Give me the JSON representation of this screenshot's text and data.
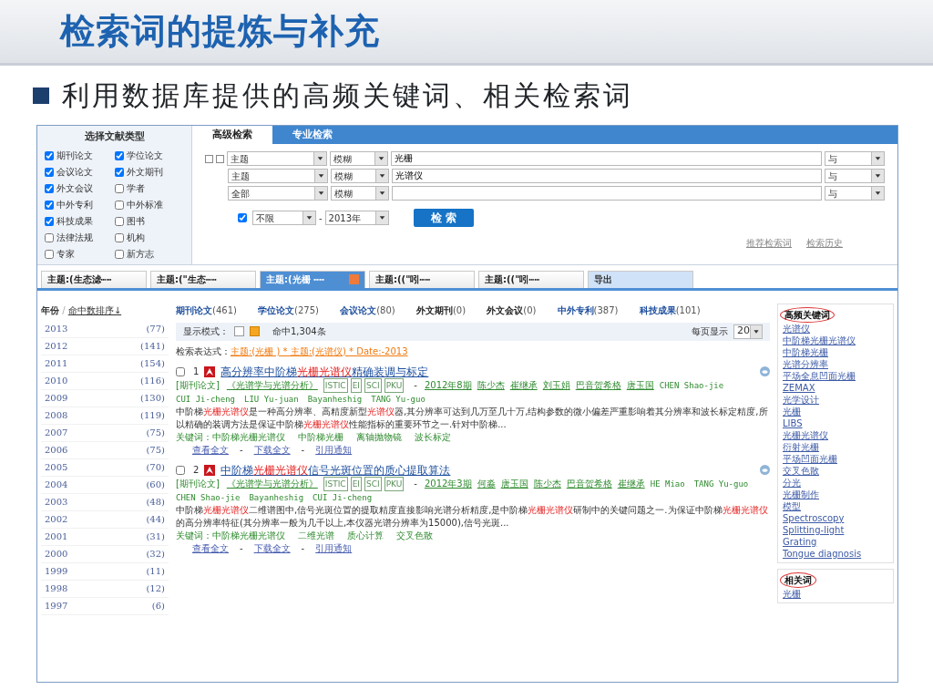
{
  "slide_title": "检索词的提炼与补充",
  "bullet": "利用数据库提供的高频关键词、相关检索词",
  "doc_types": {
    "title": "选择文献类型",
    "items": [
      {
        "label": "期刊论文",
        "checked": true
      },
      {
        "label": "学位论文",
        "checked": true
      },
      {
        "label": "会议论文",
        "checked": true
      },
      {
        "label": "外文期刊",
        "checked": true
      },
      {
        "label": "外文会议",
        "checked": true
      },
      {
        "label": "学者",
        "checked": false
      },
      {
        "label": "中外专利",
        "checked": true
      },
      {
        "label": "中外标准",
        "checked": false
      },
      {
        "label": "科技成果",
        "checked": true
      },
      {
        "label": "图书",
        "checked": false
      },
      {
        "label": "法律法规",
        "checked": false
      },
      {
        "label": "机构",
        "checked": false
      },
      {
        "label": "专家",
        "checked": false
      },
      {
        "label": "新方志",
        "checked": false
      }
    ]
  },
  "search_tabs": [
    {
      "label": "高级检索",
      "selected": true
    },
    {
      "label": "专业检索",
      "selected": false
    }
  ],
  "search_rows": [
    {
      "field": "主题",
      "match": "模糊",
      "term": "光栅",
      "logic": "与"
    },
    {
      "field": "主题",
      "match": "模糊",
      "term": "光谱仪",
      "logic": "与"
    },
    {
      "field": "全部",
      "match": "模糊",
      "logic": "与"
    }
  ],
  "date_range": {
    "checked": true,
    "from": "不限",
    "separator": "-",
    "to": "2013年"
  },
  "search_button": "检 索",
  "search_links": [
    "推荐检索词",
    "检索历史"
  ],
  "result_tabs": [
    {
      "label": "主题:(生态滤┅┅",
      "kind": "query",
      "selected": false
    },
    {
      "label": "主题:(\"生态┅┅",
      "kind": "query",
      "selected": false
    },
    {
      "label": "主题:(光栅 ┅┅",
      "kind": "query",
      "selected": true
    },
    {
      "label": "主题:((\"吲┅┅",
      "kind": "query",
      "selected": false
    },
    {
      "label": "主题:((\"吲┅┅",
      "kind": "query",
      "selected": false
    },
    {
      "label": "导出",
      "kind": "export",
      "selected": false
    }
  ],
  "year_sort": {
    "label": "年份",
    "separator": "/",
    "sort_link": "命中数排序↓"
  },
  "years": [
    {
      "year": "2013",
      "count": "(77)"
    },
    {
      "year": "2012",
      "count": "(141)"
    },
    {
      "year": "2011",
      "count": "(154)"
    },
    {
      "year": "2010",
      "count": "(116)"
    },
    {
      "year": "2009",
      "count": "(130)"
    },
    {
      "year": "2008",
      "count": "(119)"
    },
    {
      "year": "2007",
      "count": "(75)"
    },
    {
      "year": "2006",
      "count": "(75)"
    },
    {
      "year": "2005",
      "count": "(70)"
    },
    {
      "year": "2004",
      "count": "(60)"
    },
    {
      "year": "2003",
      "count": "(48)"
    },
    {
      "year": "2002",
      "count": "(44)"
    },
    {
      "year": "2001",
      "count": "(31)"
    },
    {
      "year": "2000",
      "count": "(32)"
    },
    {
      "year": "1999",
      "count": "(11)"
    },
    {
      "year": "1998",
      "count": "(12)"
    },
    {
      "year": "1997",
      "count": "(6)"
    }
  ],
  "type_counts": [
    {
      "label": "期刊论文",
      "count": "(461)",
      "disabled": false
    },
    {
      "label": "学位论文",
      "count": "(275)",
      "disabled": false
    },
    {
      "label": "会议论文",
      "count": "(80)",
      "disabled": false
    },
    {
      "label": "外文期刊",
      "count": "(0)",
      "disabled": true
    },
    {
      "label": "外文会议",
      "count": "(0)",
      "disabled": true
    },
    {
      "label": "中外专利",
      "count": "(387)",
      "disabled": false
    },
    {
      "label": "科技成果",
      "count": "(101)",
      "disabled": false
    }
  ],
  "display_bar": {
    "label": "显示模式：",
    "modes": [
      {
        "selected": false
      },
      {
        "selected": true
      }
    ],
    "hits": "命中1,304条",
    "per_page_label": "每页显示",
    "per_page": "20"
  },
  "expression": {
    "label": "检索表达式：",
    "value": "主题:(光栅 ) * 主题:(光谱仪) * Date:-2013"
  },
  "results": [
    {
      "number": "1",
      "checked": false,
      "title": [
        {
          "text": "高分辨率中阶梯",
          "highlight": false
        },
        {
          "text": "光栅光谱仪",
          "highlight": true
        },
        {
          "text": "精确装调与标定",
          "highlight": false
        }
      ],
      "source_type": "[期刊论文]",
      "journal": "《光谱学与光谱分析》",
      "tags": [
        "ISTIC",
        "EI",
        "SCI",
        "PKU"
      ],
      "separator": "-",
      "issue": "2012年8期",
      "authors": [
        "陈少杰",
        "崔继承",
        "刘玉娟",
        "巴音贺希格",
        "唐玉国"
      ],
      "authors_en": [
        "CHEN Shao-jie",
        "CUI Ji-cheng",
        "LIU Yu-juan",
        "Bayanheshig",
        "TANG Yu-guo"
      ],
      "abstract": [
        {
          "text": "中阶梯",
          "highlight": false
        },
        {
          "text": "光栅光谱仪",
          "highlight": true
        },
        {
          "text": "是一种高分辨率、高精度新型",
          "highlight": false
        },
        {
          "text": "光谱仪",
          "highlight": true
        },
        {
          "text": "器,其分辨率可达到几万至几十万,结构参数的微小偏差严重影响着其分辨率和波长标定精度,所以精确的装调方法是保证中阶梯",
          "highlight": false
        },
        {
          "text": "光栅光谱仪",
          "highlight": true
        },
        {
          "text": "性能指标的重要环节之一.针对中阶梯...",
          "highlight": false
        }
      ],
      "keywords_label": "关键词：",
      "keywords": [
        "中阶梯光栅光谱仪",
        "中阶梯光栅",
        "离轴抛物镜",
        "波长标定"
      ],
      "actions": [
        "查看全文",
        "下载全文",
        "引用通知"
      ]
    },
    {
      "number": "2",
      "checked": false,
      "title": [
        {
          "text": "中阶梯",
          "highlight": false
        },
        {
          "text": "光栅光谱仪",
          "highlight": true
        },
        {
          "text": "信号光斑位置的质心提取算法",
          "highlight": false
        }
      ],
      "source_type": "[期刊论文]",
      "journal": "《光谱学与光谱分析》",
      "tags": [
        "ISTIC",
        "EI",
        "SCI",
        "PKU"
      ],
      "separator": "-",
      "issue": "2012年3期",
      "authors": [
        "何淼",
        "唐玉国",
        "陈少杰",
        "巴音贺希格",
        "崔继承"
      ],
      "authors_en": [
        "HE Miao",
        "TANG Yu-guo",
        "CHEN Shao-jie",
        "Bayanheshig",
        "CUI Ji-cheng"
      ],
      "abstract": [
        {
          "text": "中阶梯",
          "highlight": false
        },
        {
          "text": "光栅光谱仪",
          "highlight": true
        },
        {
          "text": "二维谱图中,信号光斑位置的提取精度直接影响光谱分析精度,是中阶梯",
          "highlight": false
        },
        {
          "text": "光栅光谱仪",
          "highlight": true
        },
        {
          "text": "研制中的关键问题之一.为保证中阶梯",
          "highlight": false
        },
        {
          "text": "光栅光谱仪",
          "highlight": true
        },
        {
          "text": "的高分辨率特征(其分辨率一般为几千以上,本仪器光谱分辨率为15000),信号光斑...",
          "highlight": false
        }
      ],
      "keywords_label": "关键词：",
      "keywords": [
        "中阶梯光栅光谱仪",
        "二维光谱",
        "质心计算",
        "交叉色散"
      ],
      "actions": [
        "查看全文",
        "下载全文",
        "引用通知"
      ]
    }
  ],
  "hot_keywords": {
    "title": "高频关键词",
    "items": [
      "光谱仪",
      "中阶梯光栅光谱仪",
      "中阶梯光栅",
      "光谱分辨率",
      "平场全息凹面光栅",
      "ZEMAX",
      "光学设计",
      "光栅",
      "LIBS",
      "光栅光谱仪",
      "衍射光栅",
      "平场凹面光栅",
      "交叉色散",
      "分光",
      "光栅制作",
      "模型",
      "Spectroscopy",
      "Splitting-light",
      "Grating",
      "Tongue diagnosis"
    ]
  },
  "related_words": {
    "title": "相关词",
    "items": [
      "光栅"
    ]
  }
}
